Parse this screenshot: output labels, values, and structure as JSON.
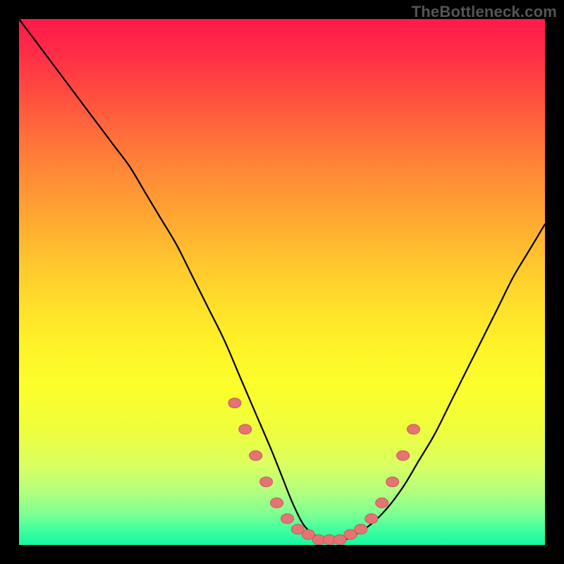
{
  "watermark": "TheBottleneck.com",
  "colors": {
    "frame": "#000000",
    "curve": "#000000",
    "dot_fill": "#e57373",
    "dot_stroke": "#c85a5a",
    "gradient_stops": [
      "#ff1a4a",
      "#ff2b47",
      "#ff4c3f",
      "#ff6e3a",
      "#ff8c36",
      "#ffa832",
      "#ffc52e",
      "#ffde2b",
      "#fff228",
      "#fbff2b",
      "#effd3c",
      "#d9ff62",
      "#b1ff7f",
      "#7fff92",
      "#42ff9e",
      "#16f8a0"
    ]
  },
  "chart_data": {
    "type": "line",
    "title": "",
    "xlabel": "",
    "ylabel": "",
    "xlim": [
      0,
      100
    ],
    "ylim": [
      0,
      100
    ],
    "grid": false,
    "legend": false,
    "series": [
      {
        "name": "bottleneck-curve",
        "x": [
          0,
          3,
          6,
          9,
          12,
          15,
          18,
          21,
          24,
          27,
          30,
          33,
          36,
          39,
          42,
          45,
          48,
          50,
          52,
          54,
          56,
          58,
          60,
          62,
          64,
          67,
          70,
          73,
          76,
          79,
          82,
          85,
          88,
          91,
          94,
          97,
          100
        ],
        "y": [
          100,
          96,
          92,
          88,
          84,
          80,
          76,
          72,
          67,
          62,
          57,
          51,
          45,
          39,
          32,
          25,
          18,
          13,
          8,
          4,
          2,
          1,
          1,
          1,
          2,
          4,
          7,
          11,
          16,
          21,
          27,
          33,
          39,
          45,
          51,
          56,
          61
        ]
      }
    ],
    "highlight_points": {
      "name": "near-zero-dots",
      "x": [
        41,
        43,
        45,
        47,
        49,
        51,
        53,
        55,
        57,
        59,
        61,
        63,
        65,
        67,
        69,
        71,
        73,
        75
      ],
      "y": [
        27,
        22,
        17,
        12,
        8,
        5,
        3,
        2,
        1,
        1,
        1,
        2,
        3,
        5,
        8,
        12,
        17,
        22
      ]
    }
  }
}
